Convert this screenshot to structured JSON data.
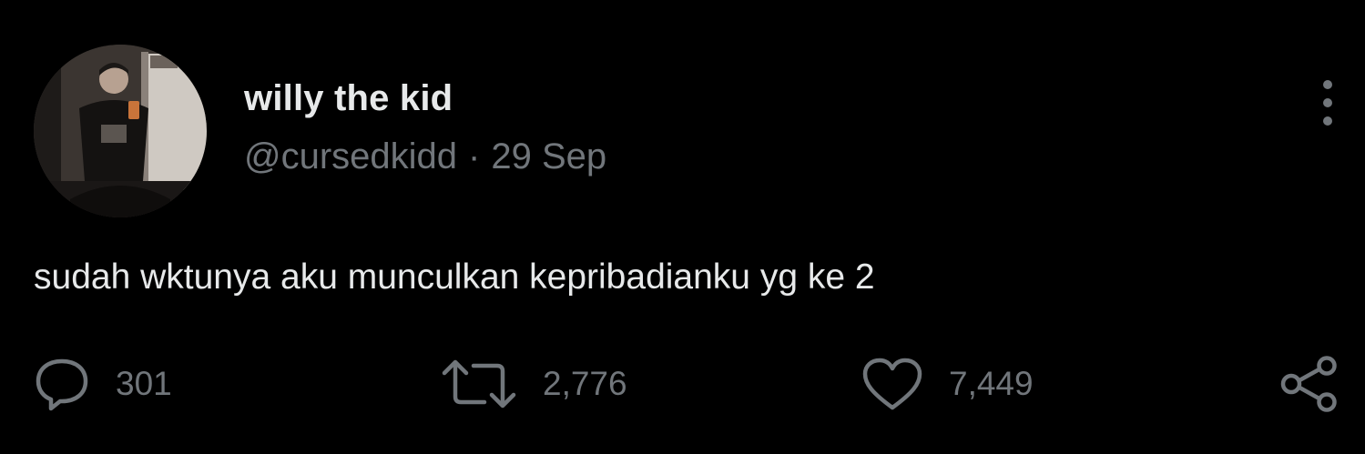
{
  "tweet": {
    "author": {
      "display_name": "willy the kid",
      "handle": "@cursedkidd"
    },
    "separator": "·",
    "date": "29 Sep",
    "text": "sudah wktunya aku munculkan kepribadianku yg ke 2",
    "actions": {
      "reply": {
        "icon": "reply-icon",
        "count": "301"
      },
      "retweet": {
        "icon": "retweet-icon",
        "count": "2,776"
      },
      "like": {
        "icon": "heart-icon",
        "count": "7,449"
      },
      "share": {
        "icon": "share-icon"
      }
    },
    "more_icon": "more-vertical-icon"
  },
  "colors": {
    "background": "#000000",
    "primary_text": "#e7e9ea",
    "secondary_text": "#71767b"
  }
}
